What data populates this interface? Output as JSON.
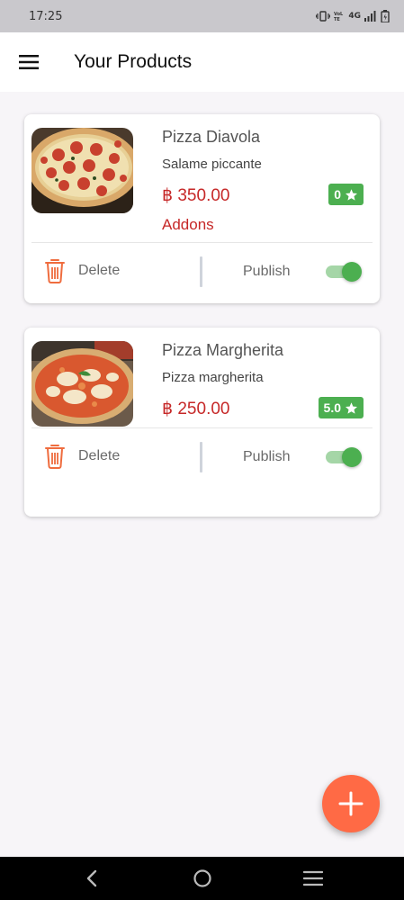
{
  "status_bar": {
    "time": "17:25",
    "network": "4G"
  },
  "app_bar": {
    "title": "Your Products",
    "menu_icon": "hamburger-menu-icon"
  },
  "products": [
    {
      "name": "Pizza Diavola",
      "description": "Salame piccante",
      "price": "฿ 350.00",
      "rating": "0",
      "addons_label": "Addons",
      "delete_label": "Delete",
      "publish_label": "Publish",
      "published": true
    },
    {
      "name": "Pizza Margherita",
      "description": "Pizza margherita",
      "price": "฿ 250.00",
      "rating": "5.0",
      "delete_label": "Delete",
      "publish_label": "Publish",
      "published": true
    }
  ],
  "colors": {
    "accent": "#ff6a45",
    "price": "#c62828",
    "rating_bg": "#4caf50",
    "toggle_on": "#4caf50",
    "delete_icon": "#ef6c3e"
  },
  "fab": {
    "icon": "plus-icon"
  },
  "nav": {
    "back": "back-icon",
    "home": "home-icon",
    "recents": "recents-icon"
  }
}
